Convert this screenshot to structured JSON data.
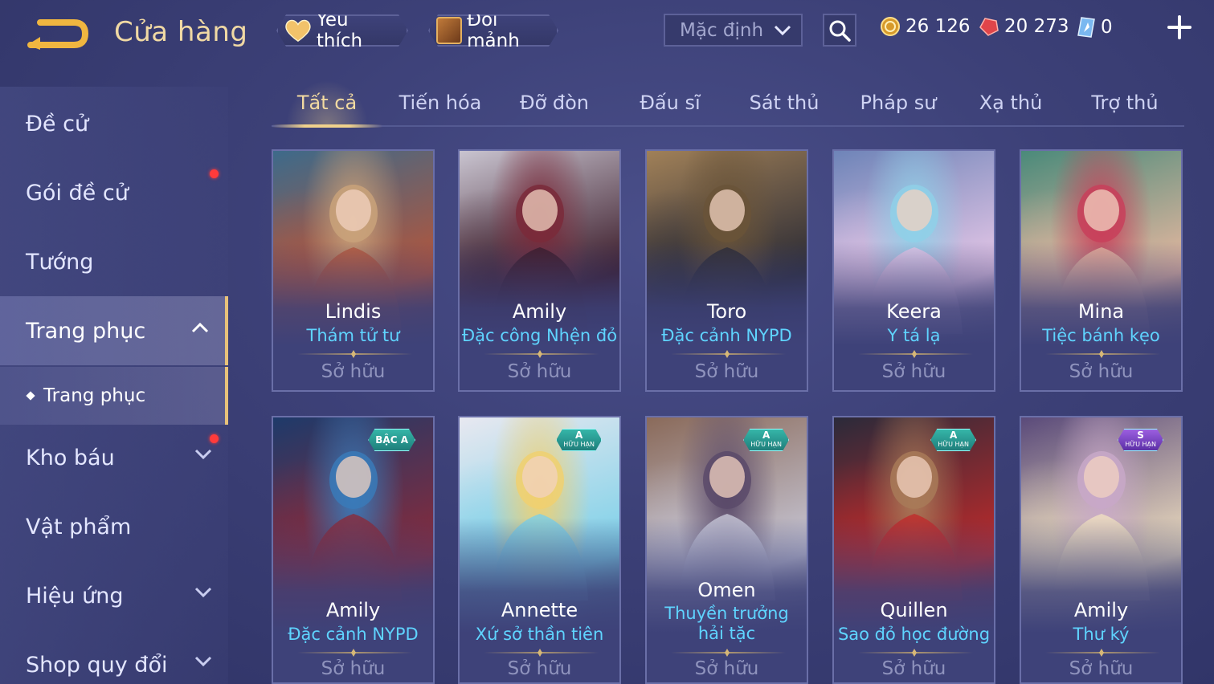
{
  "header": {
    "title": "Cửa hàng",
    "favorite_label": "Yêu thích",
    "shard_label": "Đổi mảnh",
    "sort_value": "Mặc định",
    "currencies": {
      "gold": "26 126",
      "ruby": "20 273",
      "voucher": "0"
    }
  },
  "sidebar": {
    "items": [
      {
        "label": "Đề cử"
      },
      {
        "label": "Gói đề cử"
      },
      {
        "label": "Tướng"
      },
      {
        "label": "Trang phục"
      },
      {
        "label": "Kho báu"
      },
      {
        "label": "Vật phẩm"
      },
      {
        "label": "Hiệu ứng"
      },
      {
        "label": "Shop quy đổi"
      }
    ],
    "sub_item": "Trang phục"
  },
  "tabs": [
    "Tất cả",
    "Tiến hóa",
    "Đỡ đòn",
    "Đấu sĩ",
    "Sát thủ",
    "Pháp sư",
    "Xạ thủ",
    "Trợ thủ"
  ],
  "cards": [
    {
      "hero": "Lindis",
      "skin": "Thám tử tư",
      "status": "Sở hữu",
      "colors": [
        "#c9a27a",
        "#b5553a",
        "#3d6a8a"
      ]
    },
    {
      "hero": "Amily",
      "skin": "Đặc công Nhện đỏ",
      "status": "Sở hữu",
      "colors": [
        "#7a2a3a",
        "#3a1a28",
        "#c9c4d0"
      ]
    },
    {
      "hero": "Toro",
      "skin": "Đặc cảnh NYPD",
      "status": "Sở hữu",
      "colors": [
        "#6a5438",
        "#2a2a34",
        "#a08058"
      ]
    },
    {
      "hero": "Keera",
      "skin": "Y tá lạ",
      "status": "Sở hữu",
      "colors": [
        "#8fd0e8",
        "#e8c8e8",
        "#6e84b8"
      ]
    },
    {
      "hero": "Mina",
      "skin": "Tiệc bánh kẹo",
      "status": "Sở hữu",
      "colors": [
        "#c8405a",
        "#e8b8a0",
        "#4a8a7a"
      ]
    },
    {
      "hero": "Amily",
      "skin": "Đặc cảnh NYPD",
      "status": "Sở hữu",
      "badge": "BẬC A",
      "badge_sub": "",
      "colors": [
        "#3a7ab8",
        "#8a2a3a",
        "#1e3a6a"
      ]
    },
    {
      "hero": "Annette",
      "skin": "Xứ sở thần tiên",
      "status": "Sở hữu",
      "badge": "A",
      "badge_sub": "HỮU HẠN",
      "colors": [
        "#f0d070",
        "#7ad0e8",
        "#e8e8f0"
      ]
    },
    {
      "hero": "Omen",
      "skin": "Thuyền trưởng hải tặc",
      "status": "Sở hữu",
      "badge": "A",
      "badge_sub": "HỮU HẠN",
      "colors": [
        "#5a4a6a",
        "#c8c8d8",
        "#8a6a5a"
      ]
    },
    {
      "hero": "Quillen",
      "skin": "Sao đỏ học đường",
      "status": "Sở hữu",
      "badge": "A",
      "badge_sub": "HỮU HẠN",
      "colors": [
        "#a87a58",
        "#c02a2a",
        "#2a2a3a"
      ]
    },
    {
      "hero": "Amily",
      "skin": "Thư ký",
      "status": "Sở hữu",
      "badge": "S",
      "badge_sub": "HỮU HẠN",
      "colors": [
        "#c8a8c8",
        "#f0e0c0",
        "#5a4a7a"
      ]
    }
  ],
  "colors": {
    "accent_gold": "#f0d9a4",
    "skin_cyan": "#5fd4ff",
    "notification_red": "#ff3b3b"
  }
}
